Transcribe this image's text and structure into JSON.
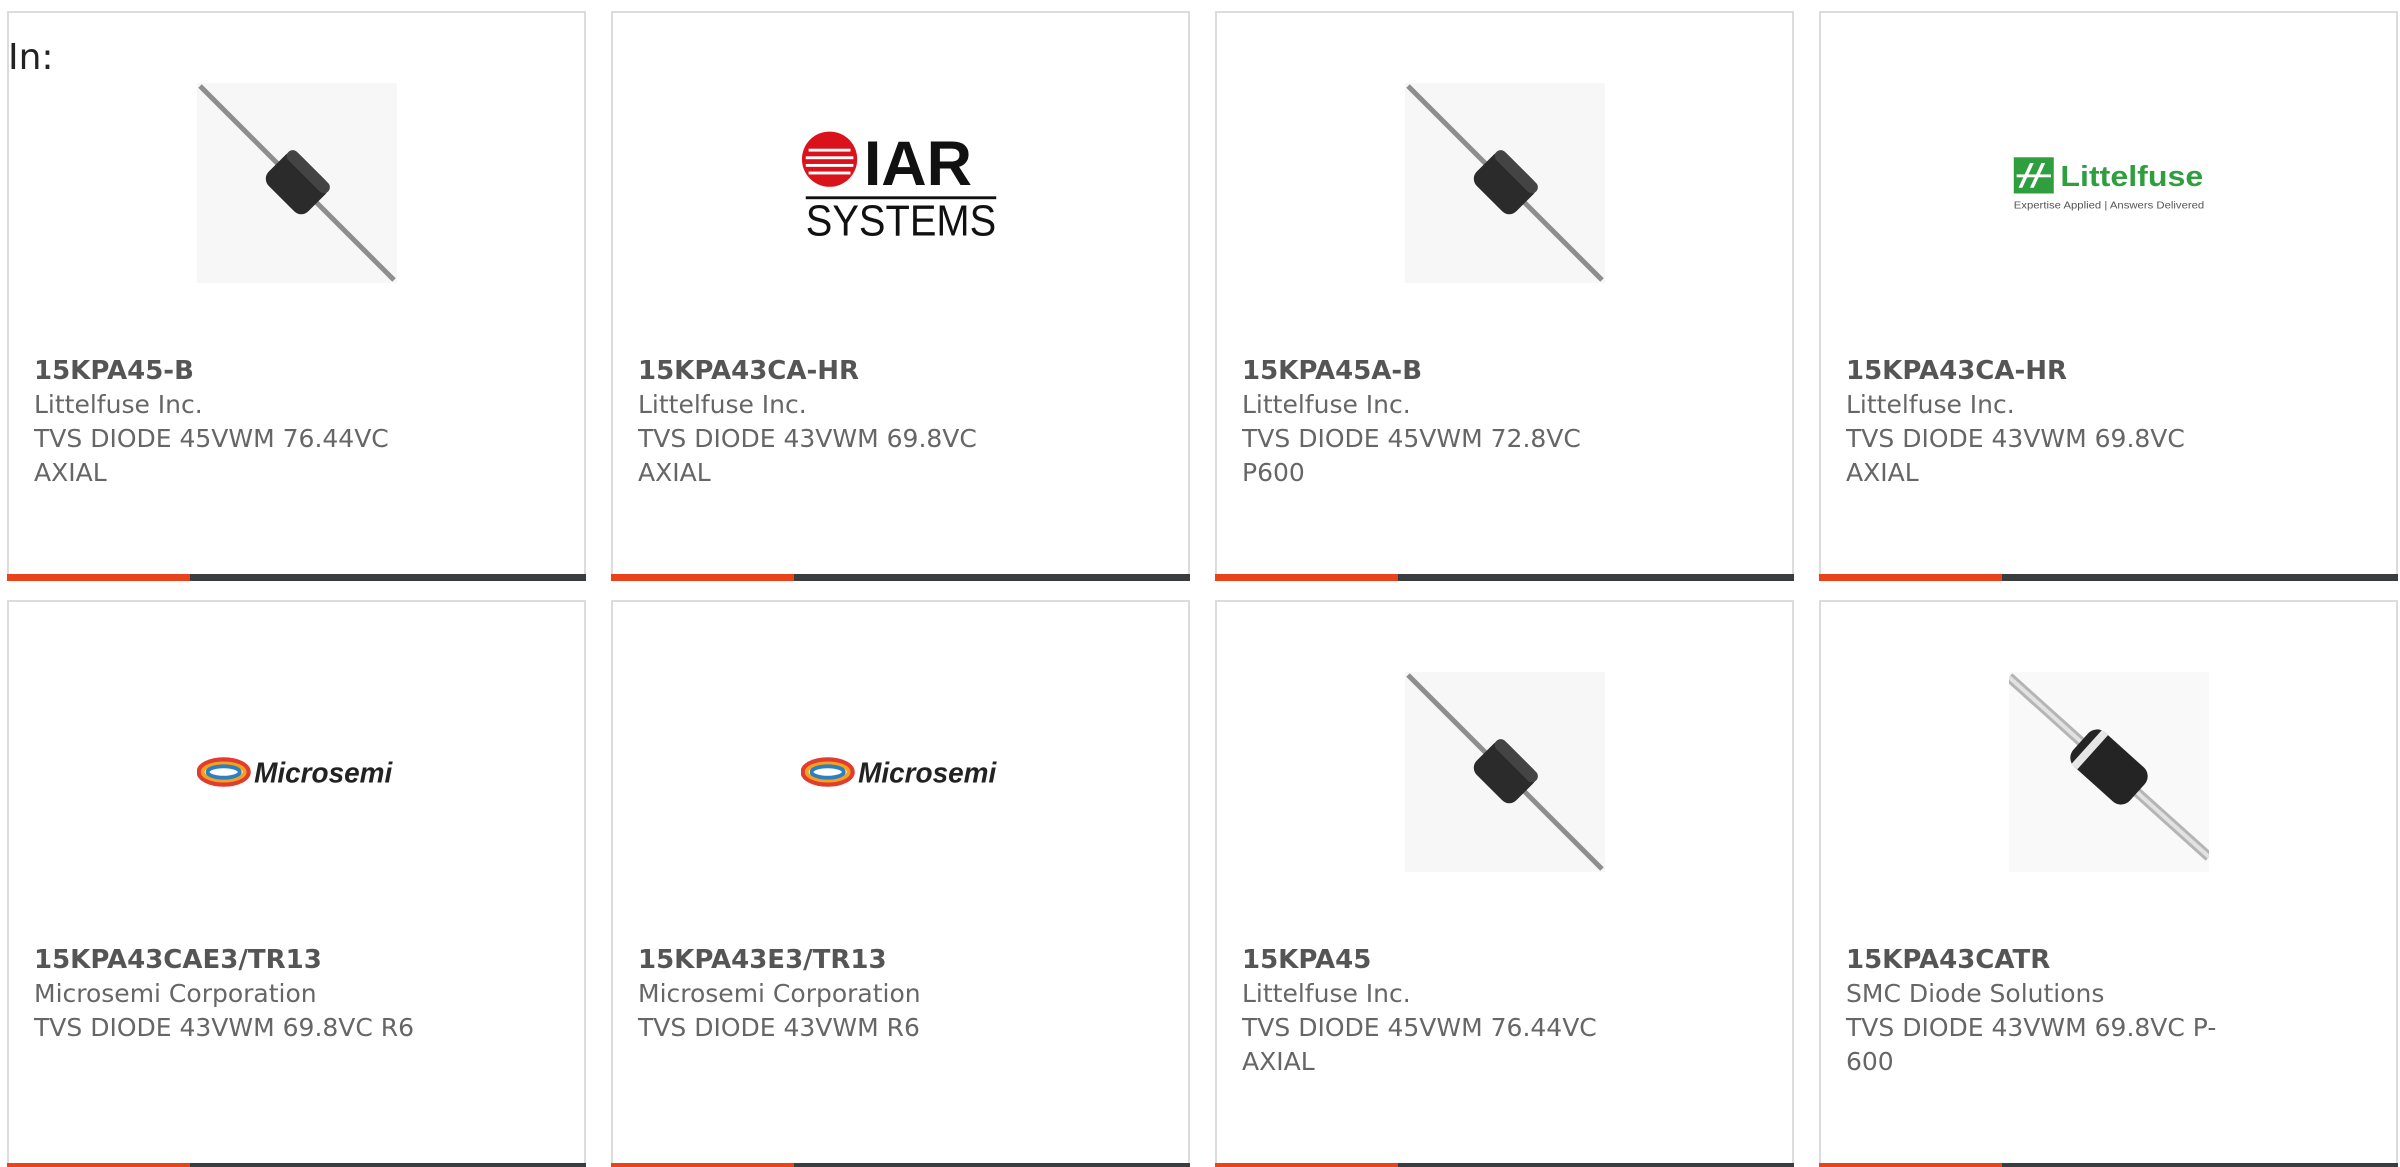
{
  "header": {
    "in_label": "In:"
  },
  "colors": {
    "accent": "#e8431a",
    "bar": "#3a3d3f",
    "border": "#dcdcdc",
    "text": "#666666"
  },
  "products": [
    {
      "part_number": "15KPA45-B",
      "manufacturer": "Littelfuse Inc.",
      "description": "TVS DIODE 45VWM 76.44VC AXIAL",
      "image": "axial-diode"
    },
    {
      "part_number": "15KPA43CA-HR",
      "manufacturer": "Littelfuse Inc.",
      "description": "TVS DIODE 43VWM 69.8VC AXIAL",
      "image": "iar-systems-logo",
      "logo_text": [
        "IAR",
        "SYSTEMS"
      ]
    },
    {
      "part_number": "15KPA45A-B",
      "manufacturer": "Littelfuse Inc.",
      "description": "TVS DIODE 45VWM 72.8VC P600",
      "image": "axial-diode"
    },
    {
      "part_number": "15KPA43CA-HR",
      "manufacturer": "Littelfuse Inc.",
      "description": "TVS DIODE 43VWM 69.8VC AXIAL",
      "image": "littelfuse-logo",
      "logo_text": [
        "Littelfuse",
        "Expertise Applied | Answers Delivered"
      ]
    },
    {
      "part_number": "15KPA43CAE3/TR13",
      "manufacturer": "Microsemi Corporation",
      "description": "TVS DIODE 43VWM 69.8VC R6",
      "image": "microsemi-logo",
      "logo_text": [
        "Microsemi"
      ]
    },
    {
      "part_number": "15KPA43E3/TR13",
      "manufacturer": "Microsemi Corporation",
      "description": "TVS DIODE 43VWM R6",
      "image": "microsemi-logo",
      "logo_text": [
        "Microsemi"
      ]
    },
    {
      "part_number": "15KPA45",
      "manufacturer": "Littelfuse Inc.",
      "description": "TVS DIODE 45VWM 76.44VC AXIAL",
      "image": "axial-diode"
    },
    {
      "part_number": "15KPA43CATR",
      "manufacturer": "SMC Diode Solutions",
      "description": "TVS DIODE 43VWM 69.8VC P-600",
      "image": "axial-diode-banded"
    }
  ]
}
